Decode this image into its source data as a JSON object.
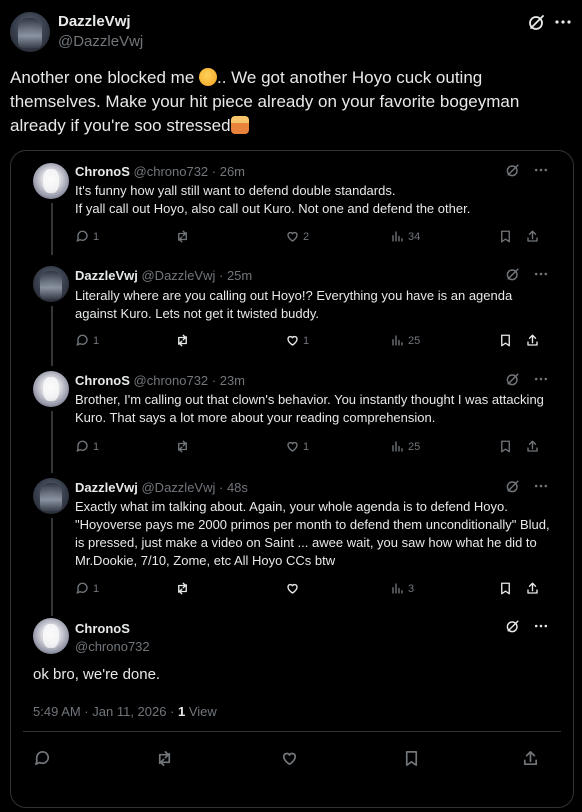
{
  "main_post": {
    "name": "DazzleVwj",
    "handle": "@DazzleVwj",
    "text_part1": "Another one blocked me ",
    "text_part2": ".. We got another Hoyo cuck outing themselves. Make your hit piece already on your favorite bogeyman already if you're soo stressed",
    "emoji_1": "face-holding-back-tears-emoji",
    "emoji_2": "person-shrugging-emoji"
  },
  "thread": [
    {
      "name": "ChronoS",
      "handle": "@chrono732",
      "time": "· 26m",
      "text": "It's funny how yall still want to defend double standards.\nIf yall call out Hoyo, also call out Kuro. Not one and defend the other.",
      "replies": "1",
      "reposts": "",
      "likes": "2",
      "views": "34"
    },
    {
      "name": "DazzleVwj",
      "handle": "@DazzleVwj",
      "time": "· 25m",
      "text": "Literally where are you calling out Hoyo!? Everything you have is an agenda against Kuro. Lets not get it twisted buddy.",
      "replies": "1",
      "reposts": "",
      "likes": "1",
      "views": "25"
    },
    {
      "name": "ChronoS",
      "handle": "@chrono732",
      "time": "· 23m",
      "text": "Brother, I'm calling out that clown's behavior. You instantly thought I was attacking Kuro. That says a lot more about your reading comprehension.",
      "replies": "1",
      "reposts": "",
      "likes": "1",
      "views": "25"
    },
    {
      "name": "DazzleVwj",
      "handle": "@DazzleVwj",
      "time": "· 48s",
      "text": "Exactly what im talking about.  Again, your whole agenda is to defend Hoyo. \"Hoyoverse pays me 2000 primos per month to defend them unconditionally\" Blud, is pressed, just make a video on Saint ... awee wait, you saw how what he did to Mr.Dookie, 7/10, Zome, etc All Hoyo CCs btw",
      "replies": "1",
      "reposts": "",
      "likes": "",
      "views": "3"
    }
  ],
  "final_post": {
    "name": "ChronoS",
    "handle": "@chrono732",
    "text": "ok bro, we're done.",
    "timestamp": "5:49 AM · Jan 11, 2026 · ",
    "views_count": "1",
    "views_label": " View"
  }
}
